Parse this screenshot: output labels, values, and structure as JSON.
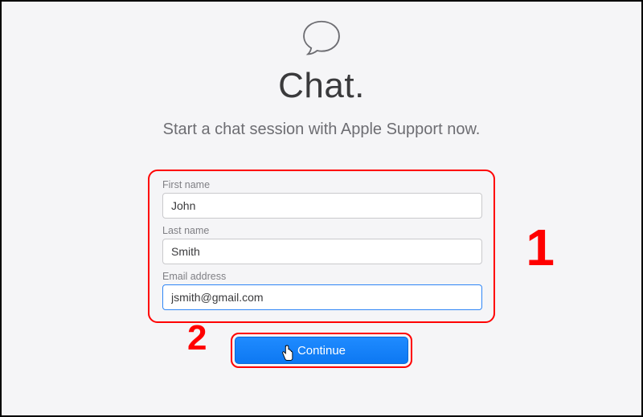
{
  "header": {
    "title": "Chat.",
    "subtitle": "Start a chat session with Apple Support now.",
    "icon": "chat-bubble-icon"
  },
  "form": {
    "first_name": {
      "label": "First name",
      "value": "John"
    },
    "last_name": {
      "label": "Last name",
      "value": "Smith"
    },
    "email": {
      "label": "Email address",
      "value": "jsmith@gmail.com"
    }
  },
  "actions": {
    "continue_label": "Continue"
  },
  "annotations": {
    "step1": "1",
    "step2": "2"
  }
}
